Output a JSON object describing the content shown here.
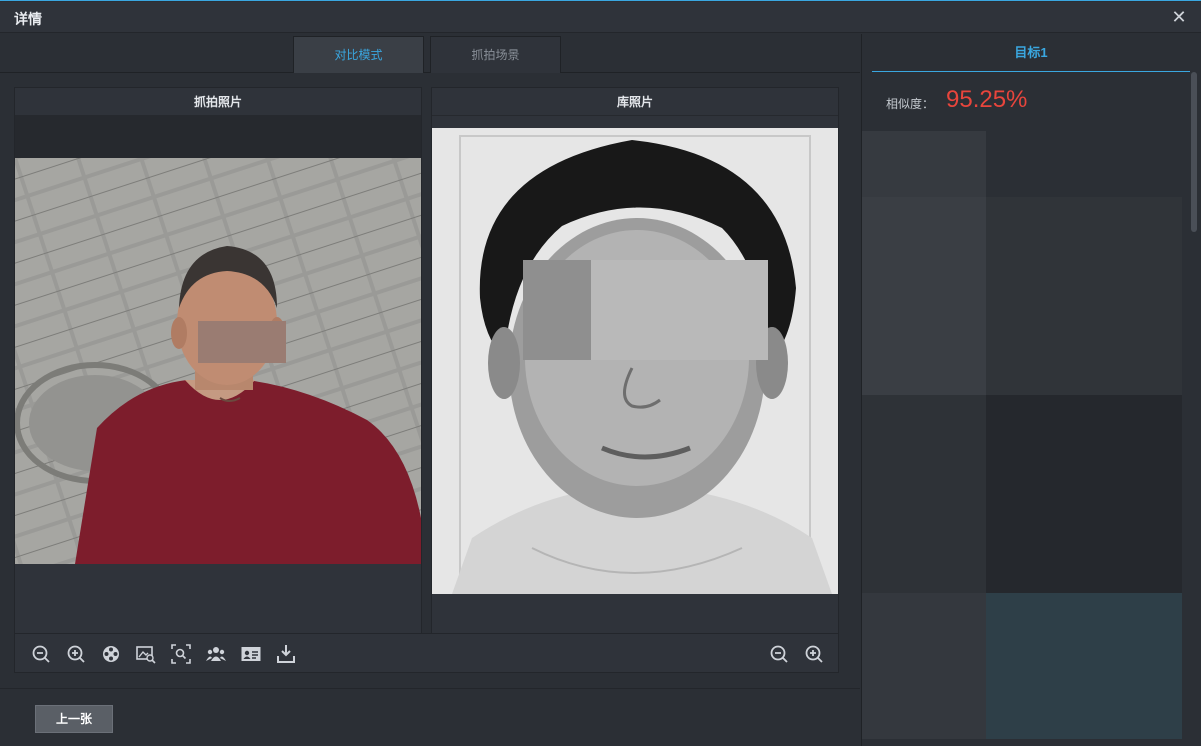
{
  "window": {
    "title": "详情",
    "close_icon": "close-icon"
  },
  "tabs": [
    {
      "label": "对比模式",
      "active": true
    },
    {
      "label": "抓拍场景",
      "active": false
    }
  ],
  "panels": {
    "capture_title": "抓拍照片",
    "library_title": "库照片"
  },
  "toolbar": {
    "left_icons": [
      "zoom-out-icon",
      "zoom-in-icon",
      "film-reel-icon",
      "image-search-icon",
      "scan-search-icon",
      "people-icon",
      "id-card-icon",
      "download-icon"
    ],
    "right_icons": [
      "zoom-out-icon",
      "zoom-in-icon"
    ]
  },
  "bottom": {
    "prev_label": "上一张"
  },
  "right_panel": {
    "target_tab": "目标1",
    "similarity_label": "相似度：",
    "similarity_value": "95.25%"
  },
  "colors": {
    "accent": "#3aa7e0",
    "similarity": "#e8453c",
    "background": "#2b2f35"
  }
}
